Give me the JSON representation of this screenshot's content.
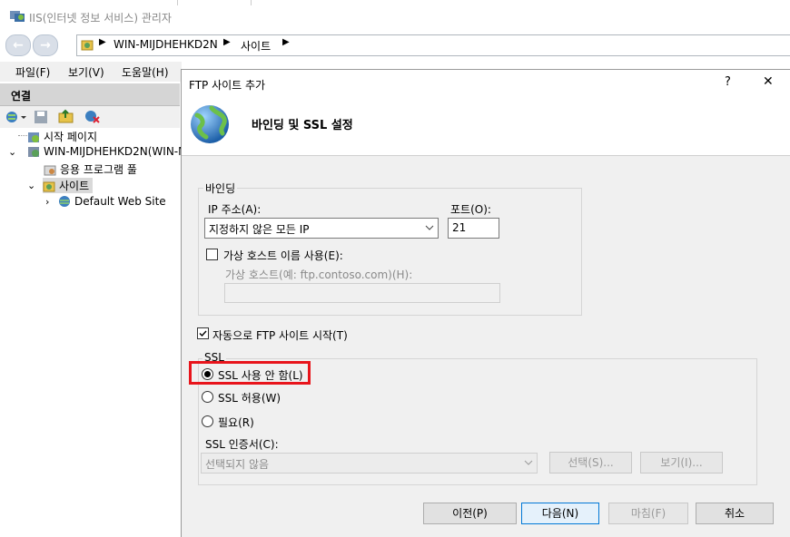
{
  "window": {
    "title": "IIS(인터넷 정보 서비스) 관리자"
  },
  "address": {
    "path": [
      "WIN-MIJDHEHKD2N",
      "사이트"
    ]
  },
  "menu": [
    "파일(F)",
    "보기(V)",
    "도움말(H)"
  ],
  "connections": {
    "header": "연결",
    "tree": [
      "시작 페이지",
      "WIN-MIJDHEHKD2N(WIN-M",
      "응용 프로그램 풀",
      "사이트",
      "Default Web Site"
    ]
  },
  "dialog": {
    "title": "FTP 사이트 추가",
    "help": "?",
    "close": "✕",
    "heading": "바인딩 및 SSL 설정",
    "binding": {
      "group": "바인딩",
      "ip_label": "IP 주소(A):",
      "ip_value": "지정하지 않은 모든 IP",
      "port_label": "포트(O):",
      "port_value": "21",
      "vhost_checkbox": "가상 호스트 이름 사용(E):",
      "vhost_label": "가상 호스트(예: ftp.contoso.com)(H):",
      "vhost_value": ""
    },
    "autostart": "자동으로 FTP 사이트 시작(T)",
    "ssl": {
      "group": "SSL",
      "options": [
        "SSL 사용 안 함(L)",
        "SSL 허용(W)",
        "필요(R)"
      ],
      "selected": 0,
      "cert_label": "SSL 인증서(C):",
      "cert_value": "선택되지 않음",
      "select_button": "선택(S)...",
      "view_button": "보기(I)..."
    },
    "buttons": {
      "prev": "이전(P)",
      "next": "다음(N)",
      "finish": "마침(F)",
      "cancel": "취소"
    },
    "highlight_color": "#e8141b"
  }
}
